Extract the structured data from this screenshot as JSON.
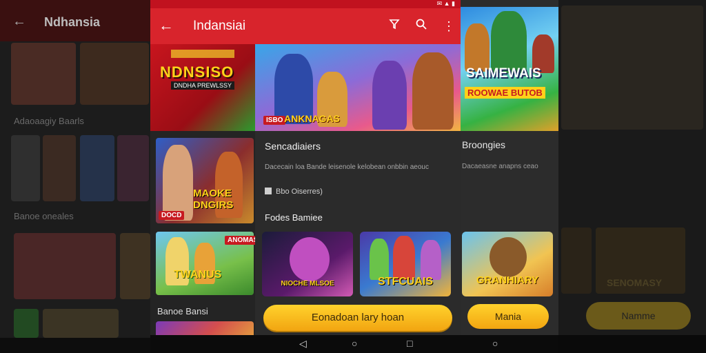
{
  "left_ghost": {
    "title": "Ndhansia",
    "section1": "Adaoaagiy Baarls",
    "section2": "Banoe oneales"
  },
  "status_bar": {
    "icons": "✉ ▲ ▮"
  },
  "app_bar": {
    "title": "Indansiai",
    "back_icon": "back-arrow-icon",
    "actions": [
      "filter-icon",
      "search-icon",
      "more-vert-icon"
    ]
  },
  "banner": {
    "headline": "NDNSISO",
    "subline": "DNDHA PREWLSSY",
    "art_label": "ANKNAGAS",
    "art_tag": "ISBO"
  },
  "left_list": {
    "card1_title": "MAOKE DNGIRS",
    "card1_tag": "DOCD",
    "card2_title": "TWANUS",
    "card2_tag": "ANOMAS",
    "section_title": "Banoe Bansi"
  },
  "detail": {
    "heading": "Sencadiaiers",
    "description": "Dacecain loa Bande leisenole kelobean onbbin aeouc",
    "meta": "Bbo Oiserres)",
    "subheading": "Fodes Bamiee",
    "tiles": [
      {
        "name": "NIOCHE MLSOE"
      },
      {
        "name": "STFCUAIS"
      }
    ],
    "cta_label": "Eonadoan lary hoan"
  },
  "right_phone": {
    "banner_line1": "SAIMEWAIS",
    "banner_line2": "ROOWAE BUTOB",
    "heading": "Broongies",
    "description": "Dacaeasne anapns ceao",
    "tile_name": "GRANHIARY",
    "cta_label": "Mania"
  },
  "right_ghost": {
    "tile_name": "SENOMASY",
    "button_label": "Namme"
  },
  "nav": {
    "back": "◁",
    "home": "○",
    "recent": "□"
  }
}
